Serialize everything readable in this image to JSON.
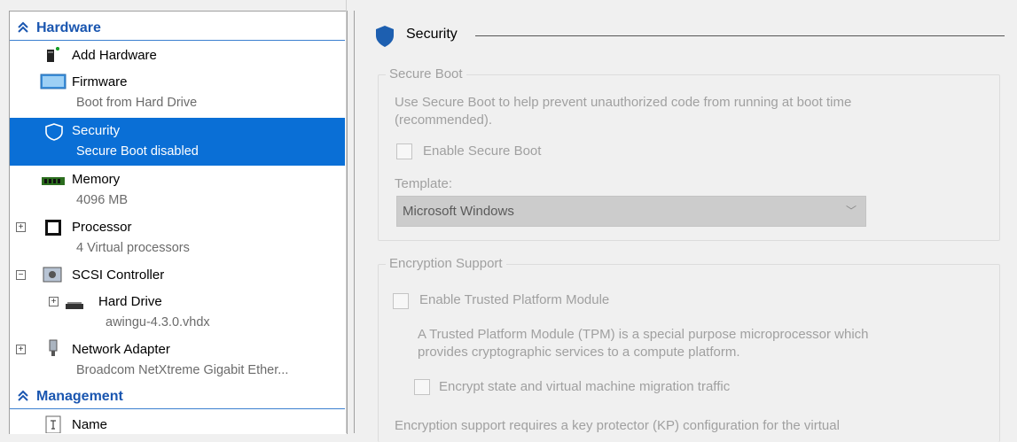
{
  "tree": {
    "hardware_label": "Hardware",
    "management_label": "Management",
    "add_hardware": "Add Hardware",
    "firmware": {
      "name": "Firmware",
      "sub": "Boot from Hard Drive"
    },
    "security": {
      "name": "Security",
      "sub": "Secure Boot disabled"
    },
    "memory": {
      "name": "Memory",
      "sub": "4096 MB"
    },
    "processor": {
      "name": "Processor",
      "sub": "4 Virtual processors"
    },
    "scsi": {
      "name": "SCSI Controller"
    },
    "hard_drive": {
      "name": "Hard Drive",
      "sub": "awingu-4.3.0.vhdx"
    },
    "network": {
      "name": "Network Adapter",
      "sub": "Broadcom NetXtreme Gigabit Ether..."
    },
    "name_item": {
      "name": "Name"
    }
  },
  "security_pane": {
    "title": "Security",
    "secure_boot": {
      "group_title": "Secure Boot",
      "description_line1": "Use Secure Boot to help prevent unauthorized code from running at boot time",
      "description_line2": "(recommended).",
      "enable_label": "Enable Secure Boot",
      "enable_checked": false,
      "template_label": "Template:",
      "template_value": "Microsoft Windows"
    },
    "encryption": {
      "group_title": "Encryption Support",
      "tpm_label": "Enable Trusted Platform Module",
      "tpm_checked": false,
      "tpm_desc_line1": "A Trusted Platform Module (TPM) is a special purpose microprocessor which",
      "tpm_desc_line2": "provides cryptographic services to a compute platform.",
      "encrypt_label": "Encrypt state and virtual machine migration traffic",
      "encrypt_checked": false,
      "footer_line": "Encryption support requires a key protector (KP) configuration for the virtual"
    }
  },
  "colors": {
    "selection": "#0a6fd6",
    "category_text": "#1a56b0",
    "disabled_text": "#a0a0a0"
  }
}
